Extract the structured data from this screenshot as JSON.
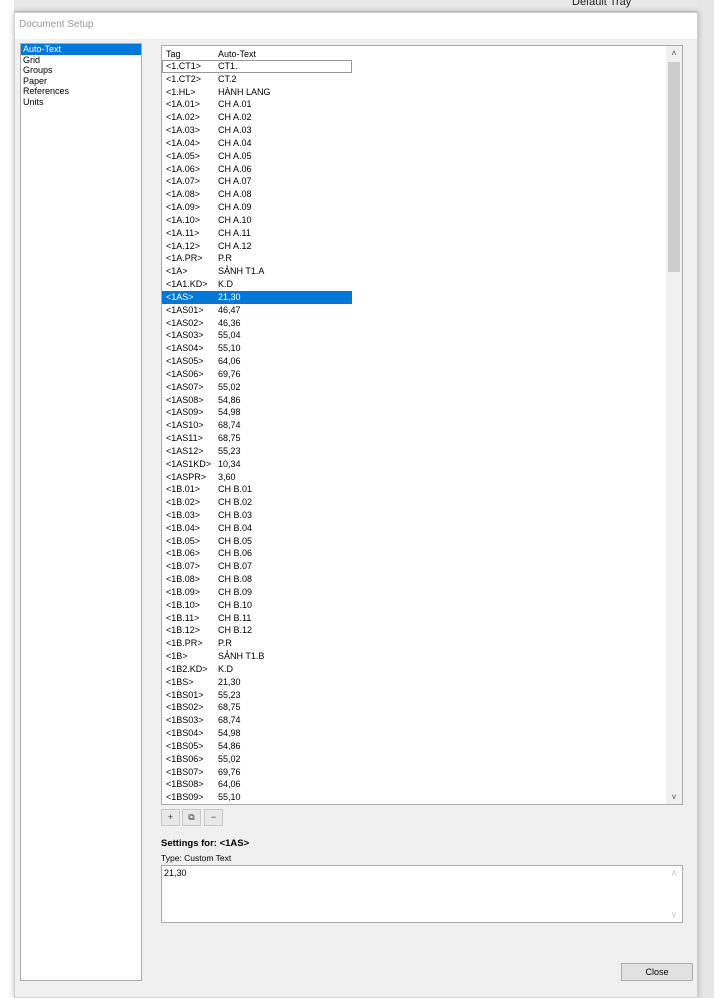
{
  "background": {
    "tray_label": "Default Tray"
  },
  "dialog": {
    "title": "Document Setup"
  },
  "nav": {
    "items": [
      "Auto-Text",
      "Grid",
      "Groups",
      "Paper",
      "References",
      "Units"
    ],
    "selected": 0
  },
  "list": {
    "headers": [
      "Tag",
      "Auto-Text"
    ],
    "rows": [
      [
        "<1.CT1>",
        "CT1."
      ],
      [
        "<1.CT2>",
        "CT.2"
      ],
      [
        "<1.HL>",
        "HÀNH LANG"
      ],
      [
        "<1A.01>",
        "CH A.01"
      ],
      [
        "<1A.02>",
        "CH A.02"
      ],
      [
        "<1A.03>",
        "CH A.03"
      ],
      [
        "<1A.04>",
        "CH A.04"
      ],
      [
        "<1A.05>",
        "CH A.05"
      ],
      [
        "<1A.06>",
        "CH A.06"
      ],
      [
        "<1A.07>",
        "CH A.07"
      ],
      [
        "<1A.08>",
        "CH A.08"
      ],
      [
        "<1A.09>",
        "CH A.09"
      ],
      [
        "<1A.10>",
        "CH A.10"
      ],
      [
        "<1A.11>",
        "CH A.11"
      ],
      [
        "<1A.12>",
        "CH A.12"
      ],
      [
        "<1A.PR>",
        "P.R"
      ],
      [
        "<1A>",
        "SẢNH T1.A"
      ],
      [
        "<1A1.KD>",
        "K.D"
      ],
      [
        "<1AS>",
        "21,30"
      ],
      [
        "<1AS01>",
        "46,47"
      ],
      [
        "<1AS02>",
        "46,36"
      ],
      [
        "<1AS03>",
        "55,04"
      ],
      [
        "<1AS04>",
        "55,10"
      ],
      [
        "<1AS05>",
        "64,06"
      ],
      [
        "<1AS06>",
        "69,76"
      ],
      [
        "<1AS07>",
        "55,02"
      ],
      [
        "<1AS08>",
        "54,86"
      ],
      [
        "<1AS09>",
        "54,98"
      ],
      [
        "<1AS10>",
        "68,74"
      ],
      [
        "<1AS11>",
        "68,75"
      ],
      [
        "<1AS12>",
        "55,23"
      ],
      [
        "<1AS1KD>",
        "10,34"
      ],
      [
        "<1ASPR>",
        "3,60"
      ],
      [
        "<1B.01>",
        "CH B.01"
      ],
      [
        "<1B.02>",
        "CH B.02"
      ],
      [
        "<1B.03>",
        "CH B.03"
      ],
      [
        "<1B.04>",
        "CH B.04"
      ],
      [
        "<1B.05>",
        "CH B.05"
      ],
      [
        "<1B.06>",
        "CH B.06"
      ],
      [
        "<1B.07>",
        "CH B.07"
      ],
      [
        "<1B.08>",
        "CH B.08"
      ],
      [
        "<1B.09>",
        "CH B.09"
      ],
      [
        "<1B.10>",
        "CH B.10"
      ],
      [
        "<1B.11>",
        "CH B.11"
      ],
      [
        "<1B.12>",
        "CH B.12"
      ],
      [
        "<1B.PR>",
        "P.R"
      ],
      [
        "<1B>",
        "SẢNH T1.B"
      ],
      [
        "<1B2.KD>",
        "K.D"
      ],
      [
        "<1BS>",
        "21,30"
      ],
      [
        "<1BS01>",
        "55,23"
      ],
      [
        "<1BS02>",
        "68,75"
      ],
      [
        "<1BS03>",
        "68,74"
      ],
      [
        "<1BS04>",
        "54,98"
      ],
      [
        "<1BS05>",
        "54,86"
      ],
      [
        "<1BS06>",
        "55,02"
      ],
      [
        "<1BS07>",
        "69,76"
      ],
      [
        "<1BS08>",
        "64,06"
      ],
      [
        "<1BS09>",
        "55,10"
      ]
    ],
    "focused": 0,
    "selected": 18,
    "scroll_position_percent": 0
  },
  "toolbar": {
    "add": "+",
    "duplicate": "⧉",
    "remove": "−"
  },
  "settings": {
    "label": "Settings for: <1AS>",
    "type": "Type: Custom Text",
    "value": "21,30"
  },
  "close_label": "Close"
}
